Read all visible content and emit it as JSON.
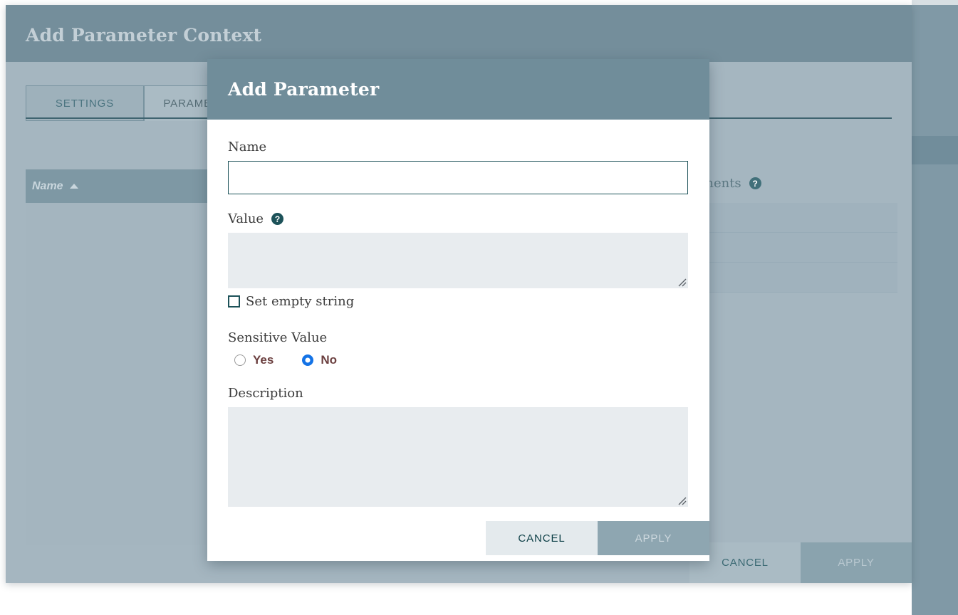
{
  "background_dialog": {
    "title": "Add Parameter Context",
    "tabs": [
      {
        "label": "SETTINGS",
        "active": false
      },
      {
        "label": "PARAMETERS",
        "active": true
      }
    ],
    "table": {
      "column_header": "Name",
      "sort_direction": "ascending",
      "sort_icon": "sort-ascending-arrow-icon"
    },
    "right_panel": {
      "label": "ponents",
      "help_icon": "help-circle-icon"
    },
    "footer": {
      "cancel_label": "CANCEL",
      "apply_label": "APPLY"
    }
  },
  "modal": {
    "title": "Add Parameter",
    "fields": {
      "name": {
        "label": "Name",
        "value": "",
        "placeholder": ""
      },
      "value": {
        "label": "Value",
        "help_icon": "help-circle-icon",
        "value": "",
        "placeholder": "",
        "resize_handle": "resize-grip-icon"
      },
      "set_empty_string": {
        "label": "Set empty string",
        "checked": false
      },
      "sensitive_value": {
        "label": "Sensitive Value",
        "options": [
          {
            "label": "Yes",
            "selected": false
          },
          {
            "label": "No",
            "selected": true
          }
        ]
      },
      "description": {
        "label": "Description",
        "value": "",
        "placeholder": "",
        "resize_handle": "resize-grip-icon"
      }
    },
    "footer": {
      "cancel_label": "CANCEL",
      "apply_label": "APPLY",
      "apply_disabled": true
    }
  },
  "colors": {
    "header_slate": "#708d9a",
    "dialog_body": "#a5b6c0",
    "accent_teal": "#1d5259",
    "radio_blue": "#1473e6",
    "input_gray": "#e8ecef",
    "cancel_bg": "#e4eaed",
    "apply_disabled_bg": "#8ea6b1"
  }
}
